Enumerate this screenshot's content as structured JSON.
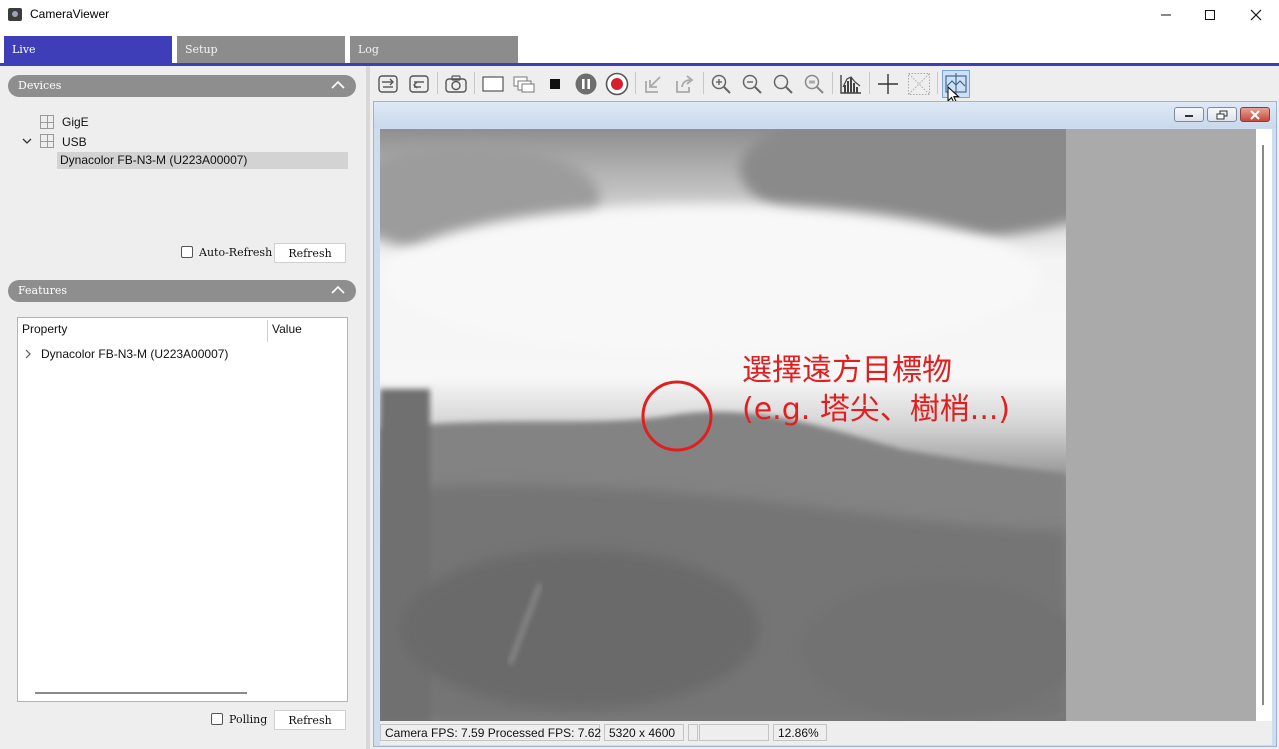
{
  "window": {
    "title": "CameraViewer"
  },
  "tabs": [
    {
      "label": "Live",
      "active": true
    },
    {
      "label": "Setup",
      "active": false
    },
    {
      "label": "Log",
      "active": false
    }
  ],
  "devices": {
    "header": "Devices",
    "tree": {
      "gige": "GigE",
      "usb": "USB",
      "selected_device": "Dynacolor FB-N3-M (U223A00007)"
    },
    "auto_refresh_label": "Auto-Refresh",
    "auto_refresh_checked": false,
    "refresh_button": "Refresh"
  },
  "features": {
    "header": "Features",
    "columns": [
      "Property",
      "Value"
    ],
    "rows": [
      {
        "property": "Dynacolor FB-N3-M (U223A00007)",
        "value": ""
      }
    ],
    "polling_label": "Polling",
    "polling_checked": false,
    "refresh_button": "Refresh"
  },
  "toolbar": {
    "icons": [
      "connect-icon",
      "disconnect-icon",
      "snapshot-camera-icon",
      "single-window-icon",
      "cascade-windows-icon",
      "stop-icon",
      "pause-icon",
      "record-icon",
      "import-icon",
      "export-share-icon",
      "zoom-in-icon",
      "zoom-out-icon",
      "zoom-fit-icon",
      "zoom-reset-icon",
      "histogram-icon",
      "crosshair-icon",
      "grid-overlay-icon",
      "focus-assist-icon"
    ],
    "active_icon": "focus-assist-icon"
  },
  "image_view": {
    "annotation_line1": "選擇遠方目標物",
    "annotation_line2": "(e.g. 塔尖、樹梢...)",
    "annotation_color": "#e02020"
  },
  "statusbar": {
    "fps": "Camera FPS: 7.59 Processed FPS: 7.62",
    "resolution": "5320 x 4600",
    "empty1": "",
    "empty2": "",
    "zoom": "12.86%"
  },
  "colors": {
    "tab_active": "#3e3eb8",
    "tab_inactive": "#8c8c8c",
    "section_header": "#8e8e8e"
  }
}
